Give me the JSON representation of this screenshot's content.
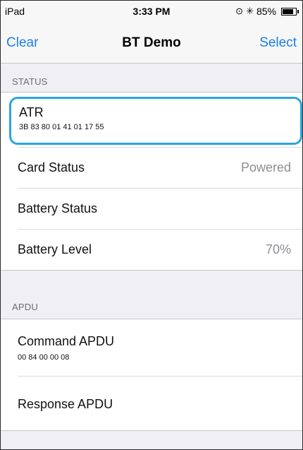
{
  "status_bar": {
    "device": "iPad",
    "time": "3:33 PM",
    "battery_percent": "85%",
    "battery_level": 0.85,
    "icons": [
      "rotation-lock-icon",
      "bluetooth-icon",
      "battery-icon"
    ]
  },
  "nav": {
    "left_label": "Clear",
    "title": "BT Demo",
    "right_label": "Select"
  },
  "sections": {
    "status": {
      "header": "STATUS",
      "atr": {
        "label": "ATR",
        "value": "3B 83 80 01 41 01 17 55"
      },
      "card_status": {
        "label": "Card Status",
        "value": "Powered"
      },
      "battery_status": {
        "label": "Battery Status",
        "value": ""
      },
      "battery_level": {
        "label": "Battery Level",
        "value": "70%"
      }
    },
    "apdu": {
      "header": "APDU",
      "command": {
        "label": "Command APDU",
        "value": "00 84 00 00 08"
      },
      "response": {
        "label": "Response APDU",
        "value": ""
      }
    }
  },
  "colors": {
    "accent": "#1a7fe6",
    "focus": "#2aa6e0",
    "background": "#efeff4"
  }
}
